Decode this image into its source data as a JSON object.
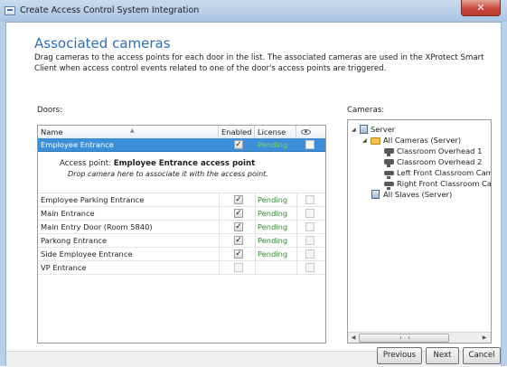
{
  "window": {
    "title": "Create Access Control System Integration",
    "close_label": "✕"
  },
  "header": {
    "title": "Associated cameras",
    "description": "Drag cameras to the access points for each door in the list. The associated cameras are used in the XProtect Smart Client when access control events related to one of the door's access points are triggered."
  },
  "doors": {
    "label": "Doors:",
    "columns": {
      "name": "Name",
      "enabled": "Enabled",
      "license": "License",
      "visibility_icon": "eye-icon"
    },
    "rows": [
      {
        "name": "Employee Entrance",
        "enabled": true,
        "license": "Pending",
        "selected": true
      },
      {
        "name": "Employee Parking Entrance",
        "enabled": true,
        "license": "Pending"
      },
      {
        "name": "Main Entrance",
        "enabled": true,
        "license": "Pending"
      },
      {
        "name": "Main Entry Door (Room 5840)",
        "enabled": true,
        "license": "Pending"
      },
      {
        "name": "Parkong Entrance",
        "enabled": true,
        "license": "Pending"
      },
      {
        "name": "Side Employee Entrance",
        "enabled": true,
        "license": "Pending"
      },
      {
        "name": "VP Entrance",
        "enabled": false,
        "license": ""
      }
    ],
    "access_point": {
      "prefix": "Access point:",
      "name": "Employee Entrance access point",
      "hint": "Drop camera here to associate it with the access point."
    }
  },
  "cameras": {
    "label": "Cameras:",
    "tree": {
      "server": "Server",
      "all_cameras": "All Cameras (Server)",
      "items": [
        {
          "label": "Classroom Overhead 1",
          "icon": "ptz-camera-icon"
        },
        {
          "label": "Classroom Overhead 2",
          "icon": "ptz-camera-icon"
        },
        {
          "label": "Left Front Classroom Camera",
          "icon": "camera-icon"
        },
        {
          "label": "Right Front Classroom Camera",
          "icon": "camera-icon"
        }
      ],
      "all_slaves": "All Slaves (Server)"
    }
  },
  "buttons": {
    "previous": "Previous",
    "next": "Next",
    "cancel": "Cancel"
  },
  "colors": {
    "selected_row": "#3a8fd8",
    "pending_text": "#2e8b2e",
    "heading": "#2f6db5"
  }
}
